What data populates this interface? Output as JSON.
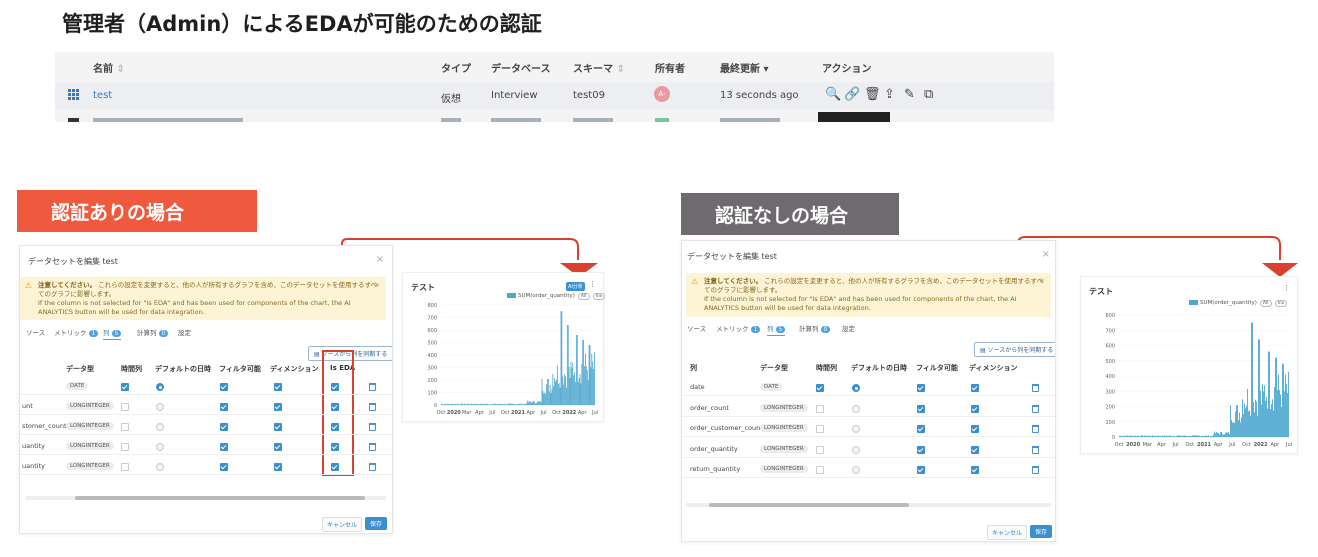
{
  "page_title": "管理者（Admin）によるEDAが可能のための認証",
  "dataset_list": {
    "headers": {
      "name": "名前",
      "type": "タイプ",
      "database": "データベース",
      "schema": "スキーマ",
      "owner": "所有者",
      "last_updated": "最終更新",
      "actions": "アクション"
    },
    "sort_markers": {
      "name": "⇕",
      "schema": "⇕",
      "last_updated": "▾"
    },
    "row": {
      "name": "test",
      "type": "仮想",
      "database": "Interview",
      "schema": "test09",
      "owner_initials": "A-",
      "last_updated": "13 seconds ago"
    },
    "action_icons": [
      "🔍",
      "🔗",
      "🗑",
      "⇪",
      "✎",
      "⧉"
    ],
    "colors": {
      "link": "#2f7fc1",
      "grid_icon": "#3b78b5",
      "avatar": "#e79aa3"
    }
  },
  "labels": {
    "with_auth": "認証ありの場合",
    "without_auth": "認証なしの場合",
    "colors": {
      "with_auth_bg": "#ef5a3f",
      "without_auth_bg": "#6e6a6f",
      "arrow": "#d9412f"
    }
  },
  "dialog_common": {
    "title": "データセットを編集 test",
    "close": "×",
    "notice_bold": "注意してください。",
    "notice_text": "これらの設定を変更すると、他の人が所有するグラフを含め、このデータセットを使用するすべてのグラフに影響します。",
    "notice_text2": "If the column is not selected for \"Is EDA\" and has been used for components of the chart, the AI ANALYTICS button will be used for data integration.",
    "notice_close": "×",
    "tabs": [
      {
        "label": "ソース",
        "count": ""
      },
      {
        "label": "メトリック",
        "count": "1"
      },
      {
        "label": "列",
        "count": "5"
      },
      {
        "label": "計算列",
        "count": "0"
      },
      {
        "label": "設定",
        "count": ""
      }
    ],
    "sync_button": "ソースから列を同期する",
    "cancel": "キャンセル",
    "save": "保存",
    "row_types": [
      "DATE",
      "LONGINTEGER",
      "LONGINTEGER",
      "LONGINTEGER",
      "LONGINTEGER"
    ]
  },
  "dialog_with_auth": {
    "headers": [
      "データ型",
      "時間列",
      "デフォルトの日時",
      "フィルタ可能",
      "ディメンション",
      "Is EDA"
    ],
    "row_names": [
      "",
      "unt",
      "stomer_count",
      "uantity",
      "uantity"
    ]
  },
  "dialog_without_auth": {
    "headers": [
      "列",
      "データ型",
      "時間列",
      "デフォルトの日時",
      "フィルタ可能",
      "ディメンション"
    ],
    "row_names": [
      "date",
      "order_count",
      "order_customer_count",
      "order_quantity",
      "return_quantity"
    ]
  },
  "chart_with_auth": {
    "badge": "AI分析",
    "menu": "⋮",
    "legend_pills": [
      "All",
      "Inv"
    ]
  },
  "chart_without_auth": {
    "menu": "⋮",
    "legend_pills": [
      "All",
      "Inv"
    ]
  },
  "chart_data": [
    {
      "type": "bar",
      "title": "テスト",
      "series": [
        {
          "name": "SUM(order_quantity)",
          "color": "#4ea7cf"
        }
      ],
      "ylim": [
        0,
        800
      ],
      "yticks": [
        0,
        100,
        200,
        300,
        400,
        500,
        600,
        700,
        800
      ],
      "xticks": [
        "Oct",
        "2020",
        "Mar",
        "Apr",
        "Jul",
        "Oct",
        "2021",
        "Apr",
        "Jul",
        "Oct",
        "2022",
        "Apr",
        "Jul"
      ],
      "segments": [
        {
          "from": 0.0,
          "to": 0.55,
          "value": 8
        },
        {
          "from": 0.55,
          "to": 0.65,
          "value": 25
        },
        {
          "from": 0.65,
          "to": 0.72,
          "value": 160
        },
        {
          "from": 0.72,
          "to": 0.85,
          "value": 250
        },
        {
          "from": 0.85,
          "to": 1.0,
          "value": 300
        }
      ],
      "peaks": [
        {
          "at": 0.78,
          "value": 750
        },
        {
          "at": 0.82,
          "value": 640
        },
        {
          "at": 0.88,
          "value": 560
        },
        {
          "at": 0.92,
          "value": 520
        },
        {
          "at": 0.96,
          "value": 480
        }
      ]
    },
    {
      "type": "bar",
      "title": "テスト",
      "series": [
        {
          "name": "SUM(order_quantity)",
          "color": "#4ea7cf"
        }
      ],
      "ylim": [
        0,
        800
      ],
      "yticks": [
        0,
        100,
        200,
        300,
        400,
        500,
        600,
        700,
        800
      ],
      "xticks": [
        "Oct",
        "2020",
        "Mar",
        "Apr",
        "Jul",
        "Oct",
        "2021",
        "Apr",
        "Jul",
        "Oct",
        "2022",
        "Apr",
        "Jul"
      ],
      "segments": [
        {
          "from": 0.0,
          "to": 0.55,
          "value": 8
        },
        {
          "from": 0.55,
          "to": 0.65,
          "value": 25
        },
        {
          "from": 0.65,
          "to": 0.72,
          "value": 160
        },
        {
          "from": 0.72,
          "to": 0.85,
          "value": 250
        },
        {
          "from": 0.85,
          "to": 1.0,
          "value": 300
        }
      ],
      "peaks": [
        {
          "at": 0.78,
          "value": 750
        },
        {
          "at": 0.82,
          "value": 640
        },
        {
          "at": 0.88,
          "value": 560
        },
        {
          "at": 0.92,
          "value": 520
        },
        {
          "at": 0.96,
          "value": 480
        }
      ]
    }
  ]
}
